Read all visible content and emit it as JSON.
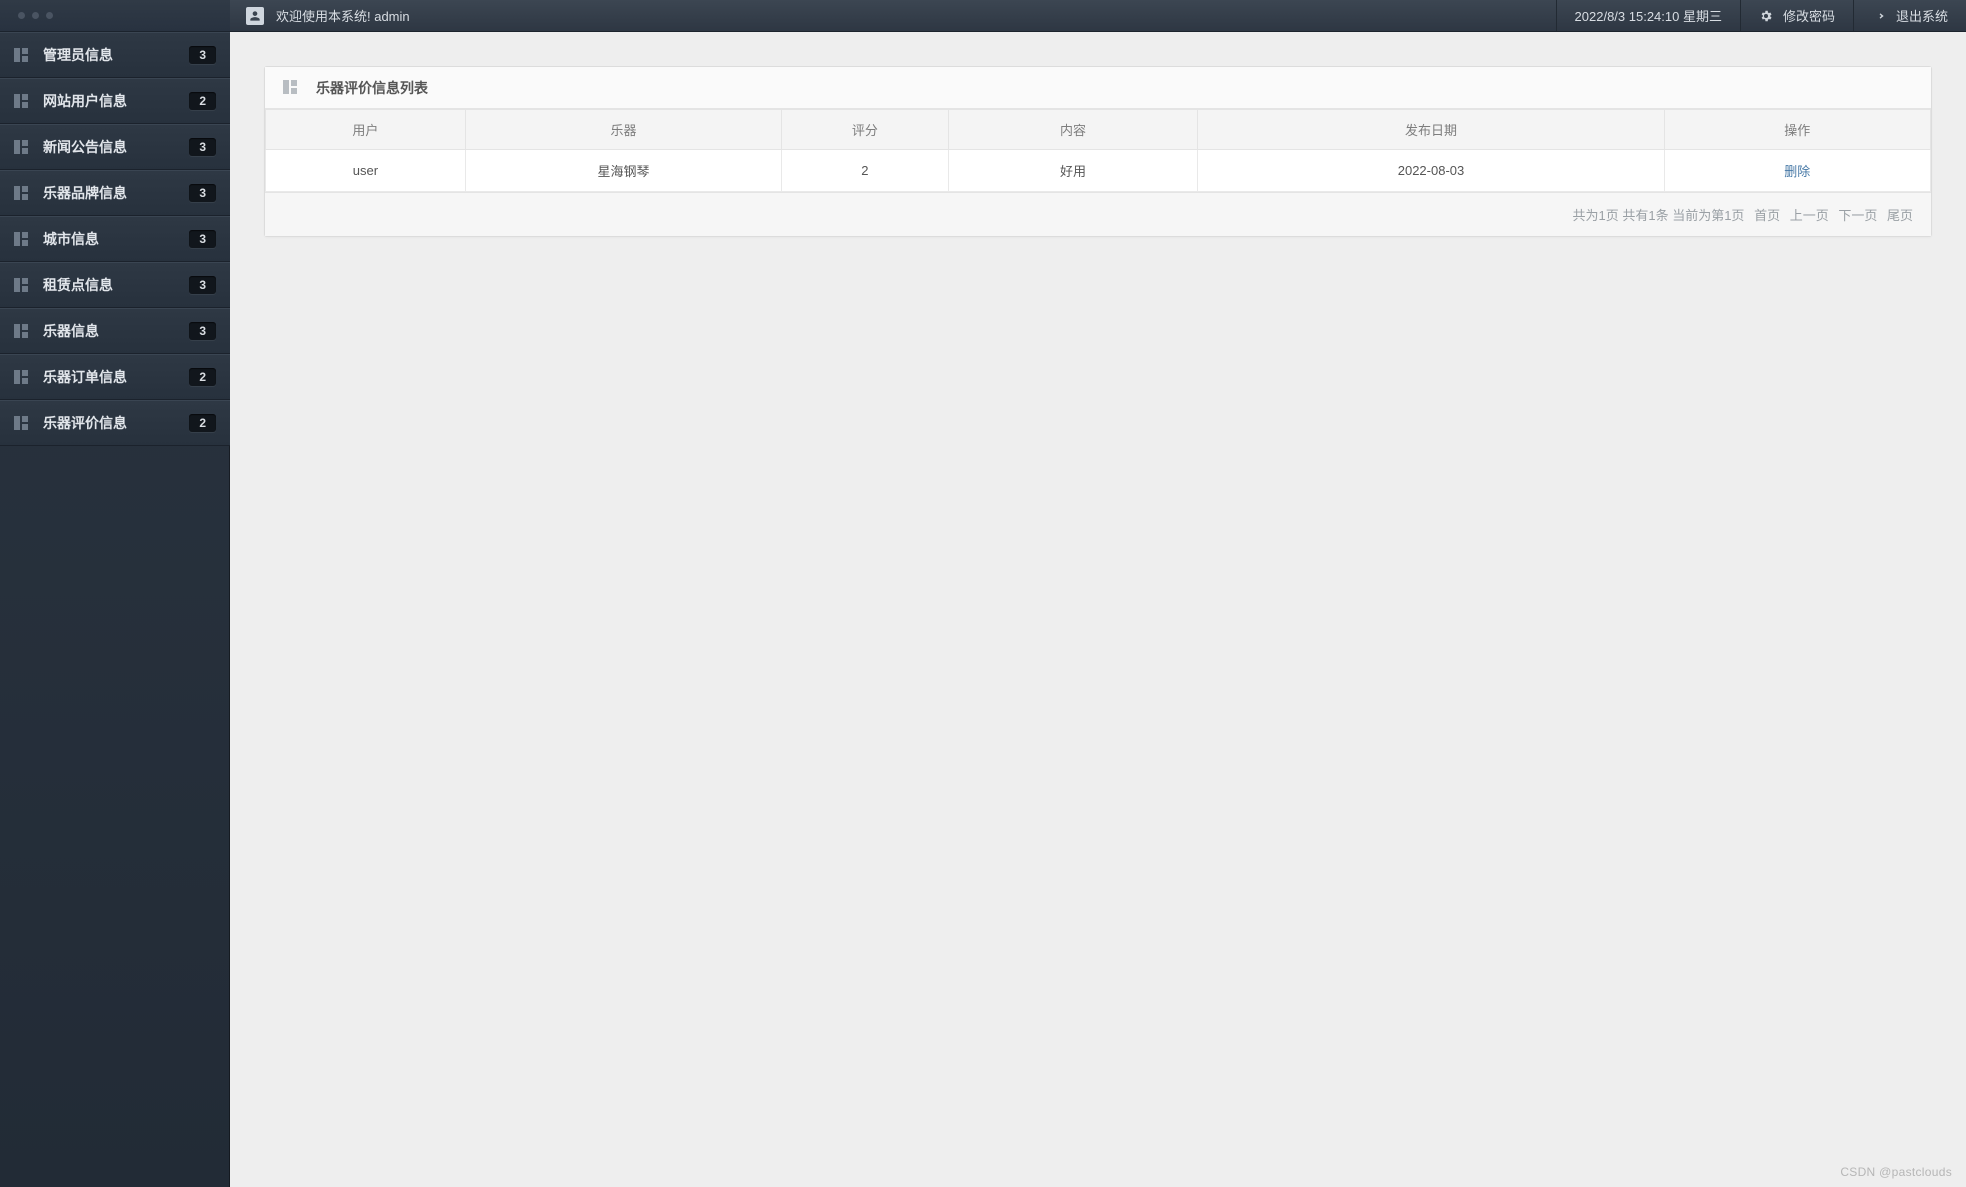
{
  "sidebar": {
    "items": [
      {
        "label": "管理员信息",
        "badge": "3"
      },
      {
        "label": "网站用户信息",
        "badge": "2"
      },
      {
        "label": "新闻公告信息",
        "badge": "3"
      },
      {
        "label": "乐器品牌信息",
        "badge": "3"
      },
      {
        "label": "城市信息",
        "badge": "3"
      },
      {
        "label": "租赁点信息",
        "badge": "3"
      },
      {
        "label": "乐器信息",
        "badge": "3"
      },
      {
        "label": "乐器订单信息",
        "badge": "2"
      },
      {
        "label": "乐器评价信息",
        "badge": "2"
      }
    ]
  },
  "header": {
    "welcome": "欢迎使用本系统! admin",
    "datetime": "2022/8/3 15:24:10 星期三",
    "change_password": "修改密码",
    "logout": "退出系统"
  },
  "panel": {
    "title": "乐器评价信息列表",
    "columns": {
      "user": "用户",
      "instrument": "乐器",
      "score": "评分",
      "content": "内容",
      "publish_date": "发布日期",
      "action": "操作"
    },
    "rows": [
      {
        "user": "user",
        "instrument": "星海钢琴",
        "score": "2",
        "content": "好用",
        "publish_date": "2022-08-03",
        "action": "删除"
      }
    ],
    "footer": {
      "summary": "共为1页  共有1条  当前为第1页",
      "first": "首页",
      "prev": "上一页",
      "next": "下一页",
      "last": "尾页"
    }
  },
  "watermark": "CSDN @pastclouds"
}
